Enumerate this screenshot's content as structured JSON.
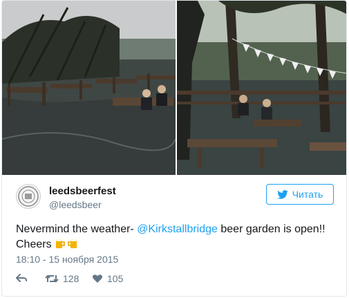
{
  "tweet": {
    "display_name": "leedsbeerfest",
    "handle": "@leedsbeer",
    "follow_label": "Читать",
    "text_before": "Nevermind the weather- ",
    "mention": "@Kirkstallbridge",
    "text_after": " beer garden is open!!",
    "text_line2": "Cheers ",
    "emoji": [
      "beer-mugs-emoji",
      "beer-mugs-emoji"
    ],
    "timestamp": "18:10 - 15 ноября 2015",
    "retweet_count": "128",
    "like_count": "105"
  },
  "media": {
    "left_photo": "flooded-beer-garden-people-photo",
    "right_photo": "flooded-beer-garden-benches-photo"
  },
  "colors": {
    "accent": "#1da1f2",
    "secondary_text": "#657786",
    "border": "#e1e8ed"
  }
}
